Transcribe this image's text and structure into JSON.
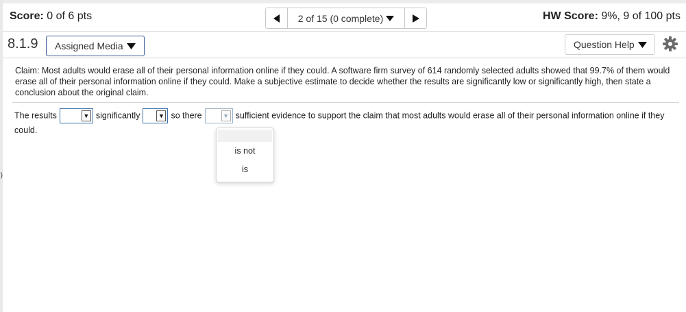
{
  "header": {
    "score_label": "Score:",
    "score_value": "0 of 6 pts",
    "nav_progress": "2 of 15 (0 complete)",
    "hw_score_label": "HW Score:",
    "hw_score_value": "9%, 9 of 100 pts"
  },
  "question_bar": {
    "question_number": "8.1.9",
    "assigned_media": "Assigned Media",
    "question_help": "Question Help"
  },
  "question": {
    "claim_text": "Claim: Most adults would erase all of their personal information online if they could. A software firm survey of 614 randomly selected adults showed that 99.7% of them would erase all of their personal information online if they could. Make a subjective estimate to decide whether the results are significantly low or significantly high, then state a conclusion about the original claim.",
    "answer_part1": "The results",
    "answer_part2": "significantly",
    "answer_part3": "so there",
    "answer_part4": "sufficient evidence to support the claim that most adults would erase all of their personal information online if they could.",
    "select1_value": "",
    "select2_value": "",
    "select3_value": ""
  },
  "dropdown": {
    "options": [
      "",
      "is not",
      "is"
    ]
  },
  "side_mark": ")",
  "icons": {
    "prev": "triangle-left-icon",
    "next": "triangle-right-icon",
    "caret": "caret-down-icon",
    "settings": "gear-icon"
  },
  "colors": {
    "accent_border": "#3b5b9a",
    "divider": "#d6d6d6"
  }
}
